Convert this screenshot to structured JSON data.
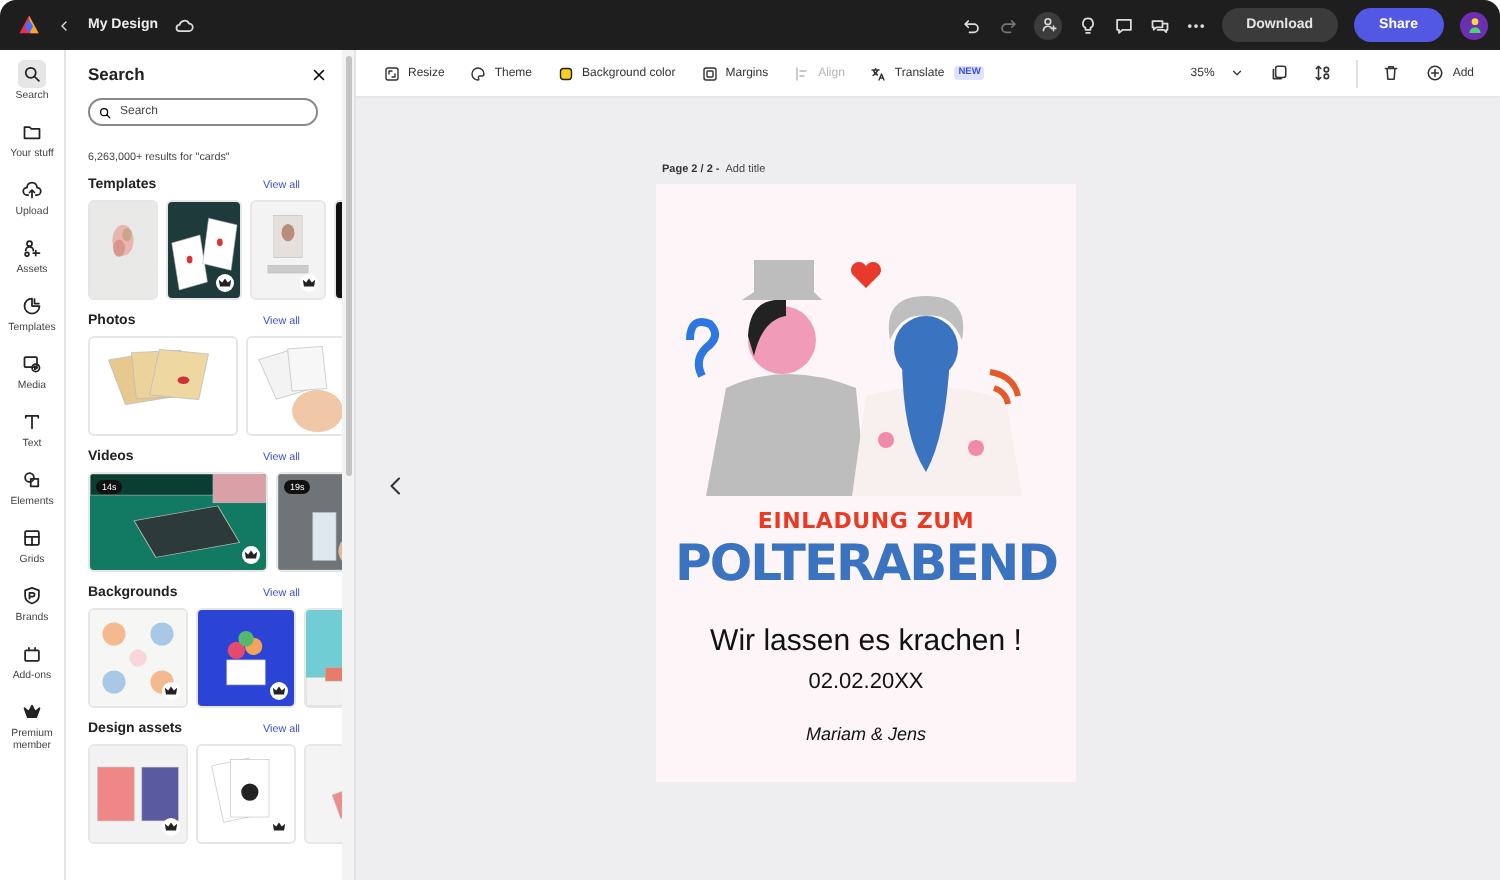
{
  "topbar": {
    "title": "My Design",
    "download": "Download",
    "share": "Share"
  },
  "rail": [
    {
      "label": "Search",
      "selected": true
    },
    {
      "label": "Your stuff",
      "selected": false
    },
    {
      "label": "Upload",
      "selected": false
    },
    {
      "label": "Assets",
      "selected": false
    },
    {
      "label": "Templates",
      "selected": false
    },
    {
      "label": "Media",
      "selected": false
    },
    {
      "label": "Text",
      "selected": false
    },
    {
      "label": "Elements",
      "selected": false
    },
    {
      "label": "Grids",
      "selected": false
    },
    {
      "label": "Brands",
      "selected": false
    },
    {
      "label": "Add-ons",
      "selected": false
    },
    {
      "label": "Premium member",
      "selected": false
    }
  ],
  "panel": {
    "title": "Search",
    "search": {
      "placeholder": "Search"
    },
    "results": "6,263,000+ results for \"cards\"",
    "sections": [
      {
        "kind": "templates",
        "title": "Templates",
        "link": "View all",
        "items": [
          {
            "premium": false
          },
          {
            "premium": true
          },
          {
            "premium": true
          },
          {
            "premium": false
          }
        ]
      },
      {
        "kind": "photos",
        "title": "Photos",
        "link": "View all",
        "items": [
          {
            "premium": false
          },
          {
            "premium": false
          }
        ]
      },
      {
        "kind": "videos",
        "title": "Videos",
        "link": "View all",
        "items": [
          {
            "duration": "14s",
            "premium": true
          },
          {
            "duration": "19s",
            "premium": false
          }
        ]
      },
      {
        "kind": "backgrounds",
        "title": "Backgrounds",
        "link": "View all",
        "items": [
          {
            "premium": true
          },
          {
            "premium": true
          },
          {
            "premium": false
          }
        ]
      },
      {
        "kind": "assets",
        "title": "Design assets",
        "link": "View all",
        "items": [
          {
            "premium": true
          },
          {
            "premium": true
          },
          {
            "premium": false
          }
        ]
      }
    ]
  },
  "toolbar": {
    "tools": [
      {
        "label": "Resize",
        "disabled": false
      },
      {
        "label": "Theme",
        "disabled": false
      },
      {
        "label": "Background color",
        "disabled": false
      },
      {
        "label": "Margins",
        "disabled": false
      },
      {
        "label": "Align",
        "disabled": true
      },
      {
        "label": "Translate",
        "disabled": false,
        "badge": "NEW"
      }
    ],
    "zoom": "35%",
    "add": "Add"
  },
  "canvas": {
    "page_label": "Page 2 / 2 -",
    "title_placeholder": "Add title",
    "design": {
      "kicker": "EINLADUNG ZUM",
      "headline": "POLTERABEND",
      "tagline": "Wir lassen es krachen !",
      "date": "02.02.20XX",
      "names": "Mariam & Jens"
    }
  }
}
